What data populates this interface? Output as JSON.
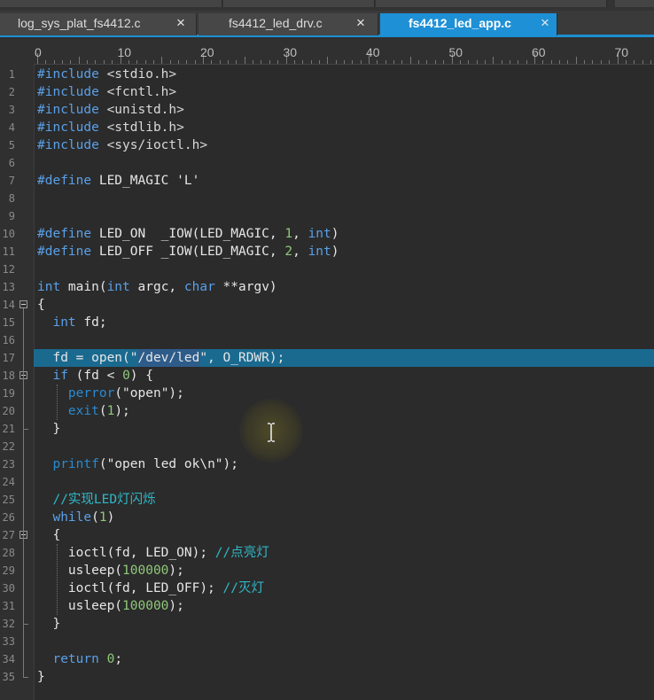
{
  "tabs": [
    {
      "label": "log_sys_plat_fs4412.c",
      "close": "×",
      "active": false
    },
    {
      "label": "fs4412_led_drv.c",
      "close": "×",
      "active": false
    },
    {
      "label": "fs4412_led_app.c",
      "close": "×",
      "active": true
    }
  ],
  "ruler": {
    "labels": [
      "0",
      "10",
      "20",
      "30",
      "40",
      "50",
      "60",
      "70"
    ]
  },
  "editor": {
    "current_line": 17,
    "lines": [
      {
        "n": "1",
        "t": [
          [
            "kw",
            "#include "
          ],
          [
            "inc",
            "<stdio.h>"
          ]
        ]
      },
      {
        "n": "2",
        "t": [
          [
            "kw",
            "#include "
          ],
          [
            "inc",
            "<fcntl.h>"
          ]
        ]
      },
      {
        "n": "3",
        "t": [
          [
            "kw",
            "#include "
          ],
          [
            "inc",
            "<unistd.h>"
          ]
        ]
      },
      {
        "n": "4",
        "t": [
          [
            "kw",
            "#include "
          ],
          [
            "inc",
            "<stdlib.h>"
          ]
        ]
      },
      {
        "n": "5",
        "t": [
          [
            "kw",
            "#include "
          ],
          [
            "inc",
            "<sys/ioctl.h>"
          ]
        ]
      },
      {
        "n": "6",
        "t": []
      },
      {
        "n": "7",
        "t": [
          [
            "kw",
            "#define "
          ],
          [
            "",
            "LED_MAGIC 'L'"
          ]
        ]
      },
      {
        "n": "8",
        "t": []
      },
      {
        "n": "9",
        "t": []
      },
      {
        "n": "10",
        "t": [
          [
            "kw",
            "#define "
          ],
          [
            "",
            "LED_ON  _IOW(LED_MAGIC, "
          ],
          [
            "num",
            "1"
          ],
          [
            "",
            ", "
          ],
          [
            "kw",
            "int"
          ],
          [
            "",
            ")"
          ]
        ]
      },
      {
        "n": "11",
        "t": [
          [
            "kw",
            "#define "
          ],
          [
            "",
            "LED_OFF _IOW(LED_MAGIC, "
          ],
          [
            "num",
            "2"
          ],
          [
            "",
            ", "
          ],
          [
            "kw",
            "int"
          ],
          [
            "",
            ")"
          ]
        ]
      },
      {
        "n": "12",
        "t": []
      },
      {
        "n": "13",
        "t": [
          [
            "kw",
            "int "
          ],
          [
            "",
            "main("
          ],
          [
            "kw",
            "int "
          ],
          [
            "",
            "argc, "
          ],
          [
            "kw",
            "char "
          ],
          [
            "",
            "**argv)"
          ]
        ]
      },
      {
        "n": "14",
        "t": [
          [
            "",
            "{"
          ]
        ]
      },
      {
        "n": "15",
        "t": [
          [
            "",
            "  "
          ],
          [
            "kw",
            "int "
          ],
          [
            "",
            "fd;"
          ]
        ]
      },
      {
        "n": "16",
        "t": []
      },
      {
        "n": "17",
        "t": [
          [
            "",
            "  fd = open(\"/dev/led\", O_RDWR);"
          ]
        ]
      },
      {
        "n": "18",
        "t": [
          [
            "",
            "  "
          ],
          [
            "kw",
            "if "
          ],
          [
            "",
            "(fd < "
          ],
          [
            "num",
            "0"
          ],
          [
            "",
            ") {"
          ]
        ]
      },
      {
        "n": "19",
        "t": [
          [
            "",
            "    "
          ],
          [
            "fn",
            "perror"
          ],
          [
            "",
            "(\"open\");"
          ]
        ]
      },
      {
        "n": "20",
        "t": [
          [
            "",
            "    "
          ],
          [
            "fn",
            "exit"
          ],
          [
            "",
            "("
          ],
          [
            "num",
            "1"
          ],
          [
            "",
            ");"
          ]
        ]
      },
      {
        "n": "21",
        "t": [
          [
            "",
            "  }"
          ]
        ]
      },
      {
        "n": "22",
        "t": []
      },
      {
        "n": "23",
        "t": [
          [
            "",
            "  "
          ],
          [
            "fn",
            "printf"
          ],
          [
            "",
            "(\"open led ok\\n\");"
          ]
        ]
      },
      {
        "n": "24",
        "t": []
      },
      {
        "n": "25",
        "t": [
          [
            "",
            "  "
          ],
          [
            "cmt",
            "//实现LED灯闪烁"
          ]
        ]
      },
      {
        "n": "26",
        "t": [
          [
            "",
            "  "
          ],
          [
            "kw",
            "while"
          ],
          [
            "",
            "("
          ],
          [
            "num",
            "1"
          ],
          [
            "",
            ")"
          ]
        ]
      },
      {
        "n": "27",
        "t": [
          [
            "",
            "  {"
          ]
        ]
      },
      {
        "n": "28",
        "t": [
          [
            "",
            "    ioctl(fd, LED_ON); "
          ],
          [
            "cmt",
            "//点亮灯"
          ]
        ]
      },
      {
        "n": "29",
        "t": [
          [
            "",
            "    usleep("
          ],
          [
            "num",
            "100000"
          ],
          [
            "",
            ");"
          ]
        ]
      },
      {
        "n": "30",
        "t": [
          [
            "",
            "    ioctl(fd, LED_OFF); "
          ],
          [
            "cmt",
            "//灭灯"
          ]
        ]
      },
      {
        "n": "31",
        "t": [
          [
            "",
            "    usleep("
          ],
          [
            "num",
            "100000"
          ],
          [
            "",
            ");"
          ]
        ]
      },
      {
        "n": "32",
        "t": [
          [
            "",
            "  }"
          ]
        ]
      },
      {
        "n": "33",
        "t": []
      },
      {
        "n": "34",
        "t": [
          [
            "",
            "  "
          ],
          [
            "kw",
            "return "
          ],
          [
            "num",
            "0"
          ],
          [
            "",
            ";"
          ]
        ]
      },
      {
        "n": "35",
        "t": [
          [
            "",
            "}"
          ]
        ]
      }
    ]
  },
  "colors": {
    "accent": "#1e90d6",
    "keyword": "#5aa0e8",
    "number": "#8fc87a",
    "comment": "#2fb8c8",
    "background": "#2b2b2b"
  },
  "icons": {
    "tab_close": "close-icon",
    "text_cursor": "ibeam-cursor-icon"
  }
}
